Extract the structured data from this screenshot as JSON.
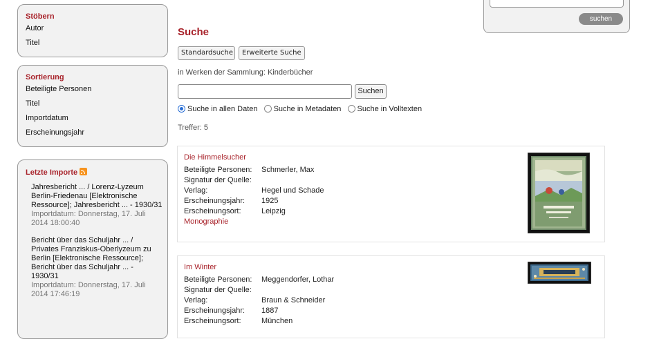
{
  "browse": {
    "title": "Stöbern",
    "items": [
      "Autor",
      "Titel"
    ]
  },
  "sort": {
    "title": "Sortierung",
    "items": [
      "Beteiligte Personen",
      "Titel",
      "Importdatum",
      "Erscheinungsjahr"
    ]
  },
  "imports": {
    "title": "Letzte Importe",
    "entries": [
      {
        "title": "Jahresbericht ... / Lorenz-Lyzeum Berlin-Friedenau [Elektronische Ressource]; Jahresbericht ... - 1930/31",
        "date": "Importdatum: Donnerstag, 17. Juli 2014 18:00:40"
      },
      {
        "title": "Bericht über das Schuljahr ... / Privates Franziskus-Oberlyzeum zu Berlin [Elektronische Ressource]; Bericht über das Schuljahr ... - 1930/31",
        "date": "Importdatum: Donnerstag, 17. Juli 2014 17:46:19"
      }
    ]
  },
  "topsearch": {
    "button": "suchen"
  },
  "main": {
    "title": "Suche",
    "tab_standard": "Standardsuche",
    "tab_advanced": "Erweiterte Suche",
    "scope": "in Werken der Sammlung: Kinderbücher",
    "search_button": "Suchen",
    "radio_all": "Suche in allen Daten",
    "radio_meta": "Suche in Metadaten",
    "radio_full": "Suche in Volltexten",
    "hits": "Treffer: 5"
  },
  "labels": {
    "persons": "Beteiligte Personen:",
    "signature": "Signatur der Quelle:",
    "publisher": "Verlag:",
    "year": "Erscheinungsjahr:",
    "place": "Erscheinungsort:"
  },
  "results": [
    {
      "title": "Die Himmelsucher",
      "persons": "Schmerler, Max",
      "signature": "",
      "publisher": "Hegel und Schade",
      "year": "1925",
      "place": "Leipzig",
      "type": "Monographie"
    },
    {
      "title": "Im Winter",
      "persons": "Meggendorfer, Lothar",
      "signature": "",
      "publisher": "Braun & Schneider",
      "year": "1887",
      "place": "München"
    }
  ]
}
